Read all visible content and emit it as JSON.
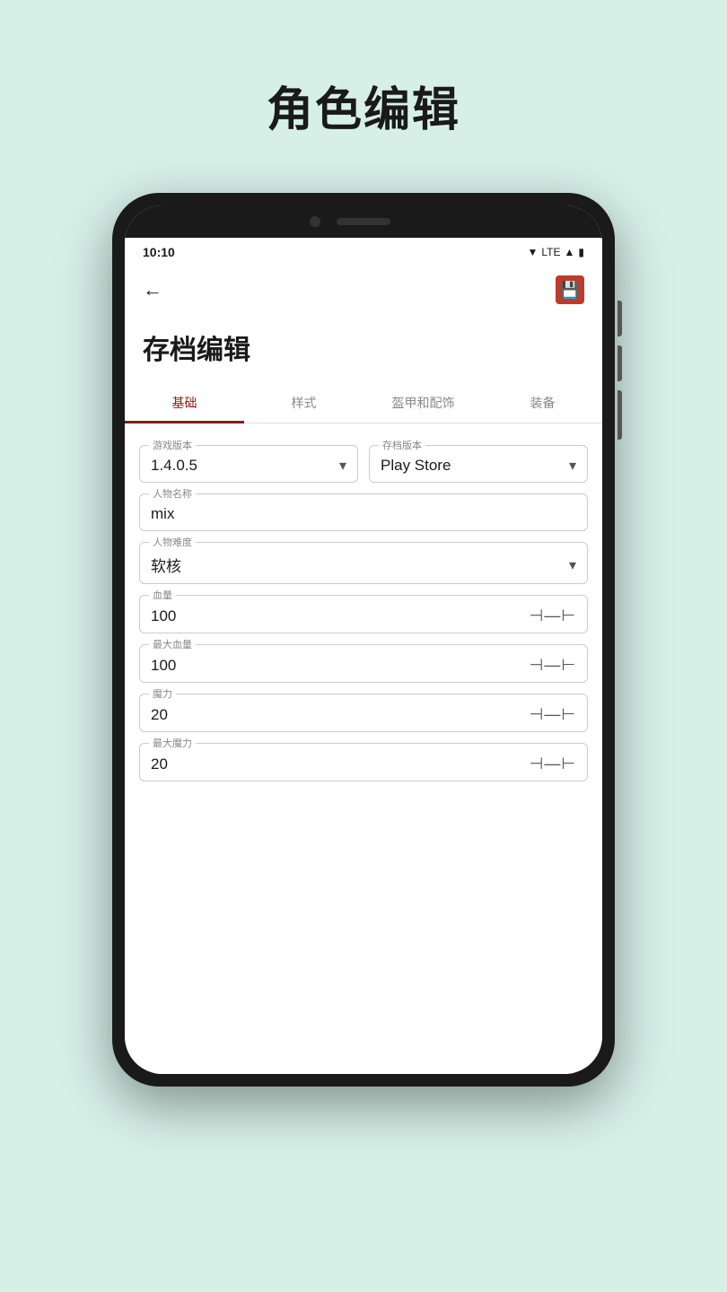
{
  "page": {
    "title": "角色编辑",
    "background": "#d6f0e8"
  },
  "status_bar": {
    "time": "10:10",
    "signal_text": "LTE"
  },
  "toolbar": {
    "back_label": "←",
    "save_icon": "💾"
  },
  "app": {
    "title": "存档编辑",
    "tabs": [
      {
        "label": "基础",
        "active": true
      },
      {
        "label": "样式",
        "active": false
      },
      {
        "label": "盔甲和配饰",
        "active": false
      },
      {
        "label": "装备",
        "active": false
      }
    ],
    "fields": {
      "game_version": {
        "label": "游戏版本",
        "value": "1.4.0.5"
      },
      "save_version": {
        "label": "存档版本",
        "value": "Play Store"
      },
      "character_name": {
        "label": "人物名称",
        "value": "mix"
      },
      "difficulty": {
        "label": "人物难度",
        "value": "软核"
      },
      "health": {
        "label": "血量",
        "value": "100"
      },
      "max_health": {
        "label": "最大血量",
        "value": "100"
      },
      "mana": {
        "label": "魔力",
        "value": "20"
      },
      "max_mana": {
        "label": "最大魔力",
        "value": "20"
      }
    }
  }
}
